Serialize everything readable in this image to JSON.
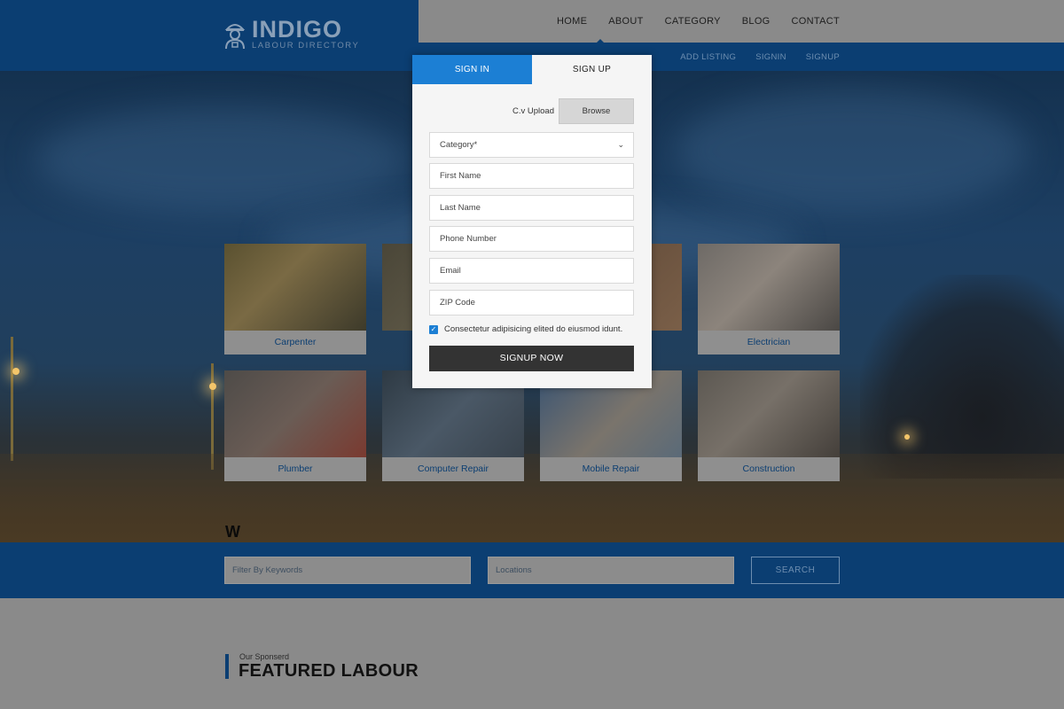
{
  "brand": {
    "name": "INDIGO",
    "tagline": "LABOUR DIRECTORY"
  },
  "nav": {
    "items": [
      "HOME",
      "ABOUT",
      "CATEGORY",
      "BLOG",
      "CONTACT"
    ],
    "active": "HOME"
  },
  "subnav": {
    "items": [
      "ADD LISTING",
      "SIGNIN",
      "SIGNUP"
    ]
  },
  "categories": [
    "Carpenter",
    "Electrician",
    "Plumber",
    "Computer Repair",
    "Mobile Repair",
    "Construction"
  ],
  "search": {
    "keywords_placeholder": "Filter By Keywords",
    "location_placeholder": "Locations",
    "button": "SEARCH"
  },
  "featured": {
    "kicker": "Our Sponserd",
    "title": "FEATURED LABOUR"
  },
  "modal": {
    "tabs": [
      "SIGN IN",
      "SIGN UP"
    ],
    "active_tab": "SIGN UP",
    "cv_label": "C.v Upload",
    "browse": "Browse",
    "category_placeholder": "Category*",
    "first_name_placeholder": "First Name",
    "last_name_placeholder": "Last Name",
    "phone_placeholder": "Phone Number",
    "email_placeholder": "Email",
    "zip_placeholder": "ZIP Code",
    "agree_text": "Consectetur adipisicing elited do eiusmod idunt.",
    "agree_checked": true,
    "submit": "SIGNUP NOW"
  },
  "colors": {
    "brand_blue": "#0b3e72",
    "accent_blue": "#1c7fd4",
    "button_dark": "#333333"
  }
}
